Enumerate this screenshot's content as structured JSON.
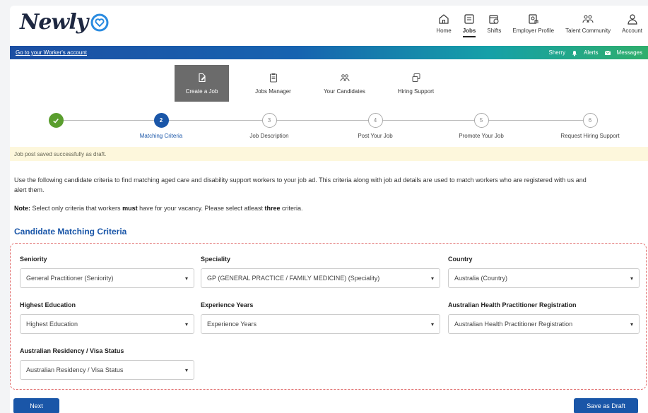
{
  "logo": {
    "text": "Newly"
  },
  "topnav": [
    {
      "label": "Home",
      "icon": "home-icon"
    },
    {
      "label": "Jobs",
      "icon": "jobs-icon",
      "active": true
    },
    {
      "label": "Shifts",
      "icon": "shifts-icon"
    },
    {
      "label": "Employer Profile",
      "icon": "employer-profile-icon"
    },
    {
      "label": "Talent Community",
      "icon": "talent-community-icon"
    },
    {
      "label": "Account",
      "icon": "account-icon"
    }
  ],
  "bluebar": {
    "worker_link": "Go to your Worker's account",
    "user": "Sherry",
    "alerts": "Alerts",
    "messages": "Messages"
  },
  "subnav": [
    {
      "label": "Create a Job",
      "icon": "create-job-icon",
      "active": true
    },
    {
      "label": "Jobs Manager",
      "icon": "clipboard-icon"
    },
    {
      "label": "Your Candidates",
      "icon": "candidates-icon"
    },
    {
      "label": "Hiring Support",
      "icon": "hiring-support-icon"
    }
  ],
  "stepper": [
    {
      "number": "",
      "label": "",
      "state": "done"
    },
    {
      "number": "2",
      "label": "Matching Criteria",
      "state": "current"
    },
    {
      "number": "3",
      "label": "Job Description",
      "state": "todo"
    },
    {
      "number": "4",
      "label": "Post Your Job",
      "state": "todo"
    },
    {
      "number": "5",
      "label": "Promote Your Job",
      "state": "todo"
    },
    {
      "number": "6",
      "label": "Request Hiring Support",
      "state": "todo"
    }
  ],
  "alert": "Job post saved successfully as draft.",
  "intro": "Use the following candidate criteria to find matching aged care and disability support workers to your job ad. This criteria along with job ad details are used to match workers who are registered with us and alert them.",
  "note": {
    "prefix": "Note:",
    "part1": " Select only criteria that workers ",
    "must": "must",
    "part2": " have for your vacancy. Please select atleast ",
    "three": "three",
    "part3": " criteria."
  },
  "section_title": "Candidate Matching Criteria",
  "fields": {
    "seniority": {
      "label": "Seniority",
      "value": "General Practitioner (Seniority)"
    },
    "speciality": {
      "label": "Speciality",
      "value": "GP (GENERAL PRACTICE / FAMILY MEDICINE) (Speciality)"
    },
    "country": {
      "label": "Country",
      "value": "Australia (Country)"
    },
    "education": {
      "label": "Highest Education",
      "value": "Highest Education"
    },
    "experience": {
      "label": "Experience Years",
      "value": "Experience Years"
    },
    "registration": {
      "label": "Australian Health Practitioner Registration",
      "value": "Australian Health Practitioner Registration"
    },
    "residency": {
      "label": "Australian Residency / Visa Status",
      "value": "Australian Residency / Visa Status"
    }
  },
  "buttons": {
    "next": "Next",
    "save_draft": "Save as Draft"
  },
  "colors": {
    "primary": "#1a56a8",
    "success": "#5a9e2e",
    "dashed_border": "#e06a6a",
    "alert_bg": "#fdf7dc"
  }
}
